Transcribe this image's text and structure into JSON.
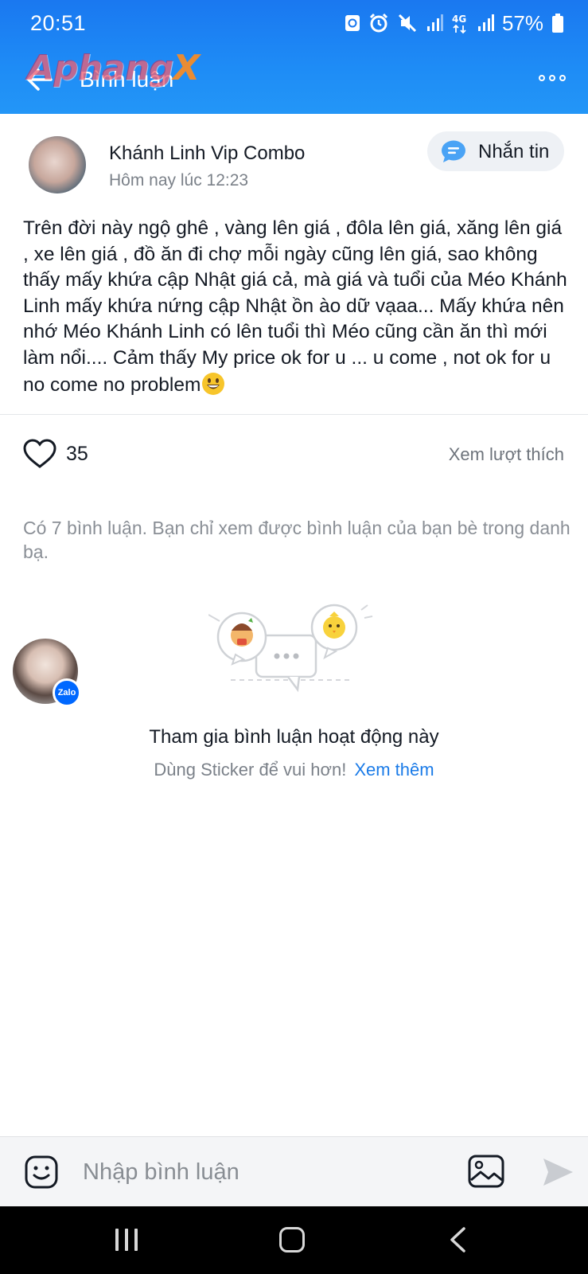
{
  "status_bar": {
    "time": "20:51",
    "network": "4G",
    "battery": "57%",
    "icons": [
      "sync-icon",
      "alarm-icon",
      "mute-icon",
      "signal-icon",
      "4g-icon",
      "signal-icon",
      "battery-icon"
    ]
  },
  "header": {
    "title": "Bình luận",
    "watermark": "Aphang",
    "watermark_x": "X",
    "back_icon": "arrow-left-icon",
    "more_icon": "more-horizontal-icon"
  },
  "post": {
    "author_name": "Khánh Linh Vip Combo",
    "timestamp": "Hôm nay lúc 12:23",
    "message_button": "Nhắn tin",
    "text": "Trên đời này ngộ ghê , vàng lên giá , đôla lên giá, xăng lên giá , xe lên giá , đồ ăn đi chợ mỗi ngày cũng lên giá, sao không thấy mấy khứa cập Nhật giá cả, mà giá và tuổi của Méo Khánh Linh mấy khứa nứng cập Nhật ồn ào dữ vạaa... Mấy khứa nên nhớ Méo Khánh Linh có lên tuổi thì Méo cũng cần ăn thì mới làm nổi.... Cảm thấy My price ok for u ... u come , not ok for u no come no problem",
    "like_count": "35",
    "view_likes": "Xem lượt thích"
  },
  "comments": {
    "note": "Có 7 bình luận. Bạn chỉ xem được bình luận của bạn bè trong danh bạ.",
    "zalo_badge": "Zalo",
    "join_title": "Tham gia bình luận hoạt động này",
    "sticker_hint": "Dùng Sticker để vui hơn!",
    "see_more": "Xem thêm"
  },
  "input": {
    "placeholder": "Nhập bình luận"
  },
  "colors": {
    "header_blue": "#1e8cf6",
    "link_blue": "#1a7be8",
    "muted_text": "#7b8189"
  }
}
